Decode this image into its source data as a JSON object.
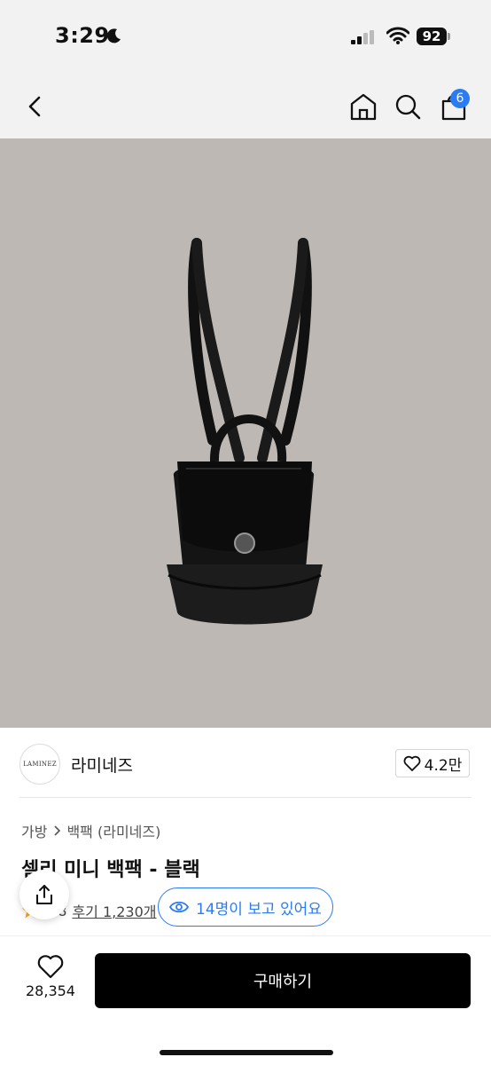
{
  "status_bar": {
    "time": "3:29",
    "battery": "92",
    "icons": [
      "moon-icon",
      "signal-icon",
      "wifi-icon",
      "battery-icon"
    ]
  },
  "nav": {
    "icons": [
      "back-chevron-icon",
      "home-icon",
      "search-icon",
      "cart-icon"
    ],
    "cart_badge": "6"
  },
  "product_image": {
    "background": "#bdb8b4",
    "subject": "black leather backpack"
  },
  "brand": {
    "logo_text": "LAMINEZ",
    "name": "라미네즈",
    "likes": "4.2만"
  },
  "breadcrumb": {
    "category": "가방",
    "subcategory": "백팩 (라미네즈)"
  },
  "product": {
    "title": "셀리 미니 백팩 - 블랙",
    "rating": "4.8",
    "reviews": "후기 1,230개"
  },
  "viewers": {
    "text": "14명이 보고 있어요"
  },
  "bottom": {
    "wish_count": "28,354",
    "buy_label": "구매하기"
  },
  "colors": {
    "accent_blue": "#2b7cf2",
    "star": "#f5a623",
    "buy_button": "#000000"
  }
}
